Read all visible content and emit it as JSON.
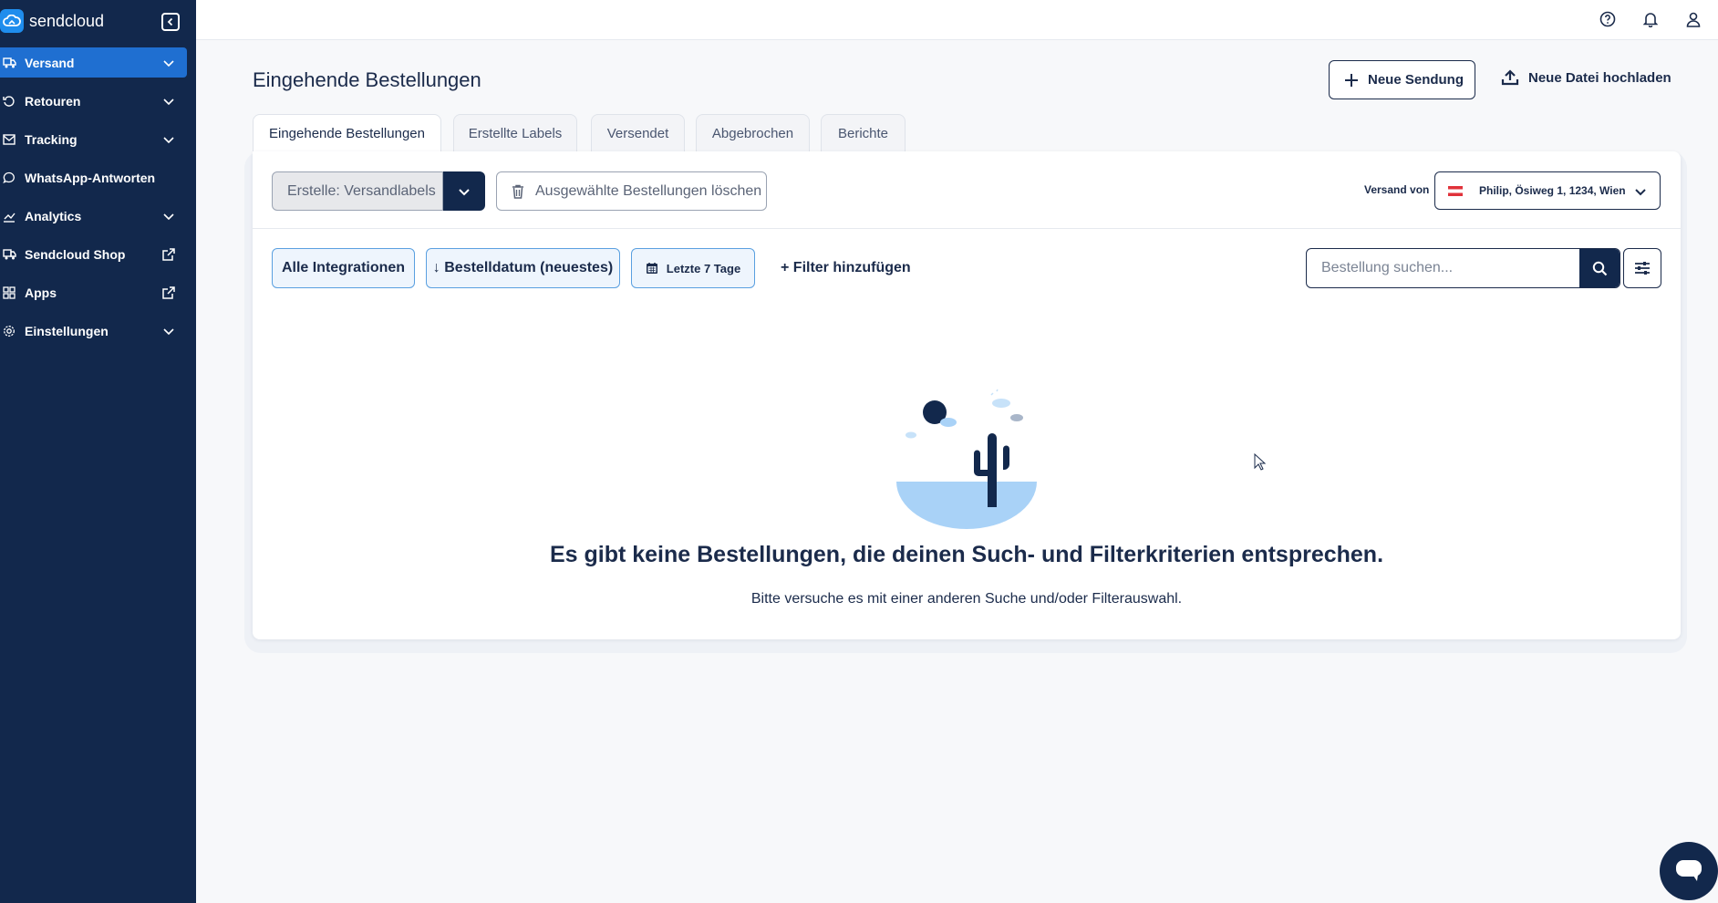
{
  "brand": {
    "name": "sendcloud"
  },
  "sidebar": {
    "items": [
      {
        "label": "Versand",
        "icon": "truck-icon",
        "active": true,
        "chevron": true
      },
      {
        "label": "Retouren",
        "icon": "return-icon",
        "active": false,
        "chevron": true
      },
      {
        "label": "Tracking",
        "icon": "mail-icon",
        "active": false,
        "chevron": true
      },
      {
        "label": "WhatsApp-Antworten",
        "icon": "chat-bubble-icon",
        "active": false,
        "chevron": false
      },
      {
        "label": "Analytics",
        "icon": "chart-icon",
        "active": false,
        "chevron": true
      },
      {
        "label": "Sendcloud Shop",
        "icon": "shop-icon",
        "active": false,
        "external": true
      },
      {
        "label": "Apps",
        "icon": "apps-icon",
        "active": false,
        "external": true
      },
      {
        "label": "Einstellungen",
        "icon": "gear-icon",
        "active": false,
        "chevron": true
      }
    ]
  },
  "header": {
    "title": "Eingehende Bestellungen",
    "new_shipment": "Neue Sendung",
    "upload_file": "Neue Datei hochladen"
  },
  "tabs": [
    {
      "label": "Eingehende Bestellungen",
      "active": true
    },
    {
      "label": "Erstellte Labels",
      "active": false
    },
    {
      "label": "Versendet",
      "active": false
    },
    {
      "label": "Abgebrochen",
      "active": false
    },
    {
      "label": "Berichte",
      "active": false
    }
  ],
  "toolbar": {
    "create_labels": "Erstelle: Versandlabels",
    "delete_selected": "Ausgewählte Bestellungen löschen",
    "ship_from_label": "Versand von",
    "ship_from_value": "Philip, Ösiweg 1, 1234, Wien"
  },
  "filters": {
    "integrations": "Alle Integrationen",
    "sort": "↓ Bestelldatum (neuestes)",
    "date_range": "Letzte 7 Tage",
    "add_filter": "+ Filter hinzufügen",
    "search_placeholder": "Bestellung suchen..."
  },
  "empty_state": {
    "title": "Es gibt keine Bestellungen, die deinen Such- und Filterkriterien entsprechen.",
    "subtitle": "Bitte versuche es mit einer anderen Suche und/oder Filterauswahl."
  },
  "colors": {
    "sidebar_bg": "#12284c",
    "accent": "#1f6fd1",
    "chip_border": "#5aa0e0",
    "text_primary": "#1b2b4b"
  }
}
